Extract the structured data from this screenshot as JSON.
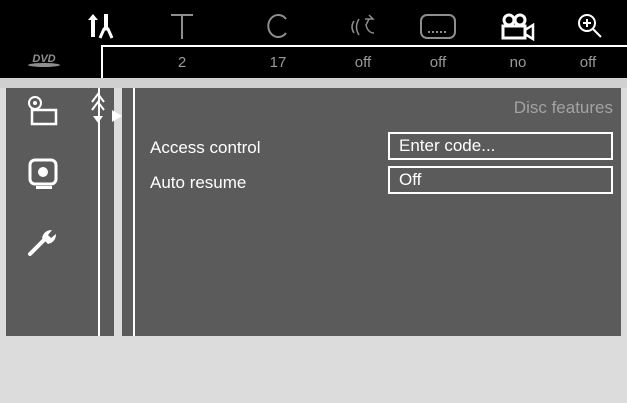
{
  "top_menu": {
    "icons": [
      "preferences-icon",
      "title-icon",
      "chapter-icon",
      "audio-icon",
      "subtitle-icon",
      "angle-icon",
      "zoom-icon"
    ],
    "values": [
      "",
      "2",
      "17",
      "off",
      "off",
      "no",
      "off"
    ],
    "disc_logo": "DVD"
  },
  "side_menu": {
    "icons": [
      "disc-features-icon",
      "playback-icon",
      "setup-icon"
    ]
  },
  "panel": {
    "title": "Disc features",
    "rows": [
      {
        "label": "Access control",
        "value": "Enter code..."
      },
      {
        "label": "Auto resume",
        "value": "Off"
      }
    ]
  },
  "colors": {
    "background": "#dcdcdc",
    "top_bar": "#000000",
    "menu_panel": "#5b5b5b",
    "text": "#ffffff",
    "muted_text": "#9a9a9a"
  }
}
